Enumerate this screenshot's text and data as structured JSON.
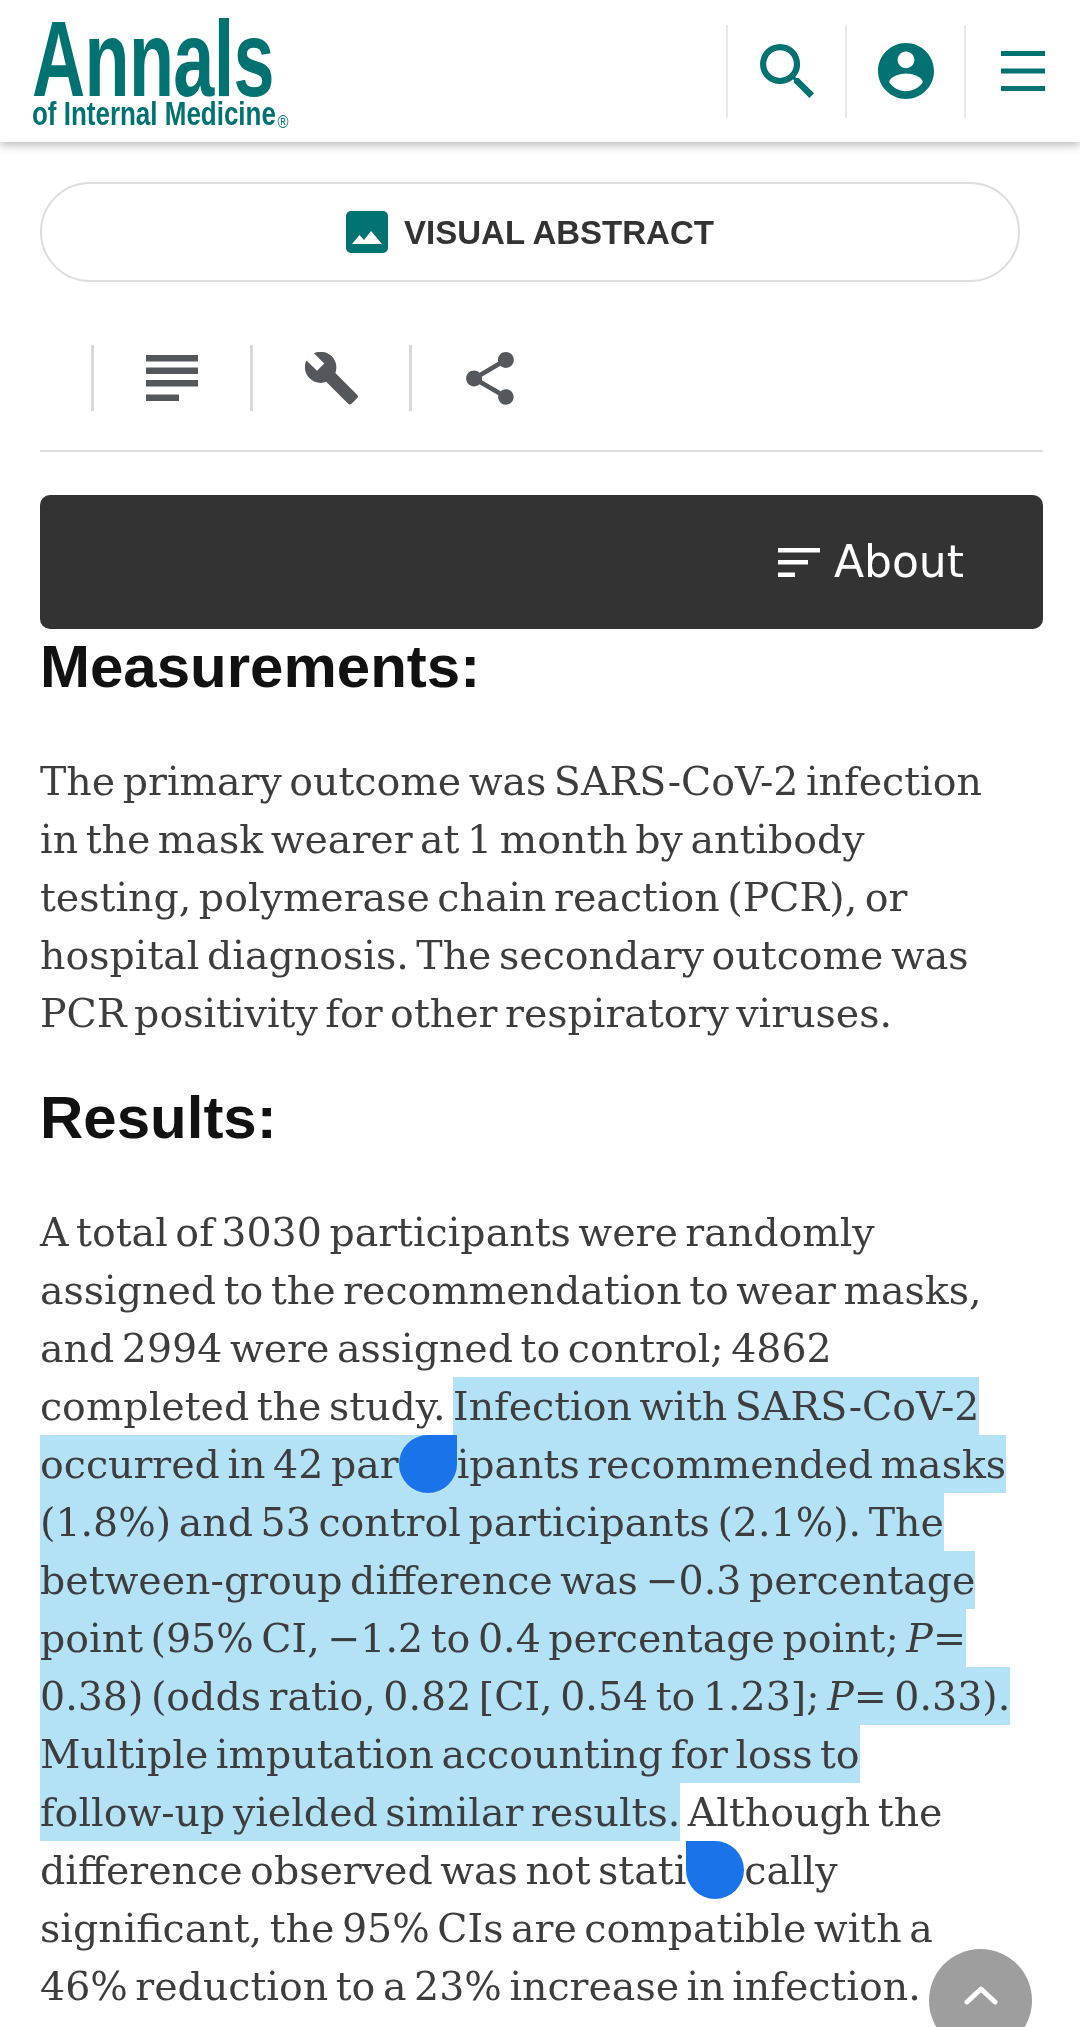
{
  "header": {
    "logo": {
      "title": "Annals",
      "subtitle": "of Internal Medicine",
      "mark": "®"
    }
  },
  "visual_abstract_button": {
    "label": "VISUAL ABSTRACT"
  },
  "section_menu": {
    "label": "About"
  },
  "sections": [
    {
      "heading": "Measurements:",
      "segments": [
        {
          "kind": "text",
          "text": "The primary outcome was SARS-CoV-2 infection in the mask wearer at 1 month by antibody testing, polymerase chain reaction (PCR), or hospital diagnosis. The secondary outcome was PCR positivity for other respiratory viruses.",
          "selected": false
        }
      ]
    },
    {
      "heading": "Results:",
      "segments": [
        {
          "kind": "text",
          "text": "A total of 3030 participants were randomly assigned to the recommendation to wear masks, and 2994 were assigned to control; 4862 completed the study. ",
          "selected": false
        },
        {
          "kind": "text",
          "text": "Infection with SARS-CoV-2 occurred in 42 par",
          "selected": true
        },
        {
          "kind": "anchor"
        },
        {
          "kind": "text",
          "text": "ipants recommended masks (1.8%) and 53 control participants (2.1%). The between-group difference was −0.3 percentage point (95% CI, −1.2 to 0.4 percentage point; *P*= 0.38) (odds ratio, 0.82 [CI, 0.54 to 1.23]; *P*= 0.33). Multiple imputation accounting for loss to follow-up yielded similar results.",
          "selected": true
        },
        {
          "kind": "text",
          "text": " Although the difference observed was not stati",
          "selected": false
        },
        {
          "kind": "focus"
        },
        {
          "kind": "text",
          "text": "cally significant, the 95% CIs are compatible with a 46% reduction to a 23% increase in infection.",
          "selected": false
        }
      ]
    }
  ]
}
